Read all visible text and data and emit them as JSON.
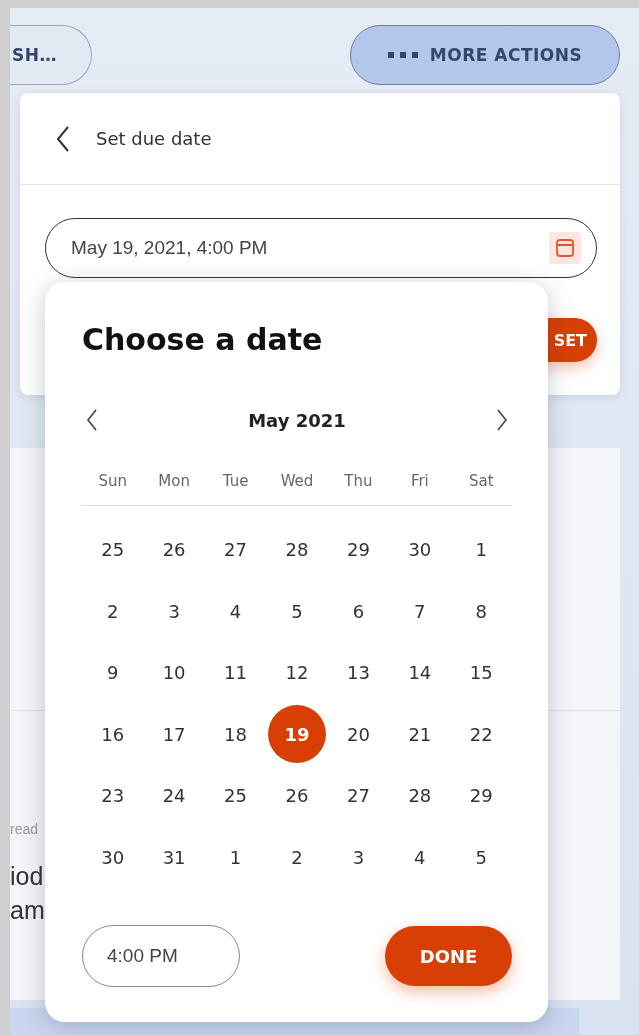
{
  "toolbar": {
    "buttons": [
      {
        "label": "SH…",
        "kind": "outline"
      },
      {
        "label": "MORE ACTIONS",
        "kind": "primary"
      }
    ]
  },
  "background_fragments": [
    {
      "text": "read",
      "kind": "caption"
    },
    {
      "text": "iod",
      "kind": "body"
    },
    {
      "text": "am",
      "kind": "body"
    }
  ],
  "panel": {
    "title": "Set due date",
    "field": {
      "value": "May 19, 2021, 4:00 PM"
    },
    "reset_button": "SET"
  },
  "date_picker": {
    "title": "Choose a date",
    "month": "May 2021",
    "weekdays": [
      "Sun",
      "Mon",
      "Tue",
      "Wed",
      "Thu",
      "Fri",
      "Sat"
    ],
    "weeks": [
      [
        {
          "day": "25",
          "selected": false
        },
        {
          "day": "26",
          "selected": false
        },
        {
          "day": "27",
          "selected": false
        },
        {
          "day": "28",
          "selected": false
        },
        {
          "day": "29",
          "selected": false
        },
        {
          "day": "30",
          "selected": false
        },
        {
          "day": "1",
          "selected": false
        }
      ],
      [
        {
          "day": "2",
          "selected": false
        },
        {
          "day": "3",
          "selected": false
        },
        {
          "day": "4",
          "selected": false
        },
        {
          "day": "5",
          "selected": false
        },
        {
          "day": "6",
          "selected": false
        },
        {
          "day": "7",
          "selected": false
        },
        {
          "day": "8",
          "selected": false
        }
      ],
      [
        {
          "day": "9",
          "selected": false
        },
        {
          "day": "10",
          "selected": false
        },
        {
          "day": "11",
          "selected": false
        },
        {
          "day": "12",
          "selected": false
        },
        {
          "day": "13",
          "selected": false
        },
        {
          "day": "14",
          "selected": false
        },
        {
          "day": "15",
          "selected": false
        }
      ],
      [
        {
          "day": "16",
          "selected": false
        },
        {
          "day": "17",
          "selected": false
        },
        {
          "day": "18",
          "selected": false
        },
        {
          "day": "19",
          "selected": true
        },
        {
          "day": "20",
          "selected": false
        },
        {
          "day": "21",
          "selected": false
        },
        {
          "day": "22",
          "selected": false
        }
      ],
      [
        {
          "day": "23",
          "selected": false
        },
        {
          "day": "24",
          "selected": false
        },
        {
          "day": "25",
          "selected": false
        },
        {
          "day": "26",
          "selected": false
        },
        {
          "day": "27",
          "selected": false
        },
        {
          "day": "28",
          "selected": false
        },
        {
          "day": "29",
          "selected": false
        }
      ],
      [
        {
          "day": "30",
          "selected": false
        },
        {
          "day": "31",
          "selected": false
        },
        {
          "day": "1",
          "selected": false
        },
        {
          "day": "2",
          "selected": false
        },
        {
          "day": "3",
          "selected": false
        },
        {
          "day": "4",
          "selected": false
        },
        {
          "day": "5",
          "selected": false
        }
      ]
    ],
    "time": {
      "value": "4:00 PM"
    },
    "done_button": "DONE"
  }
}
